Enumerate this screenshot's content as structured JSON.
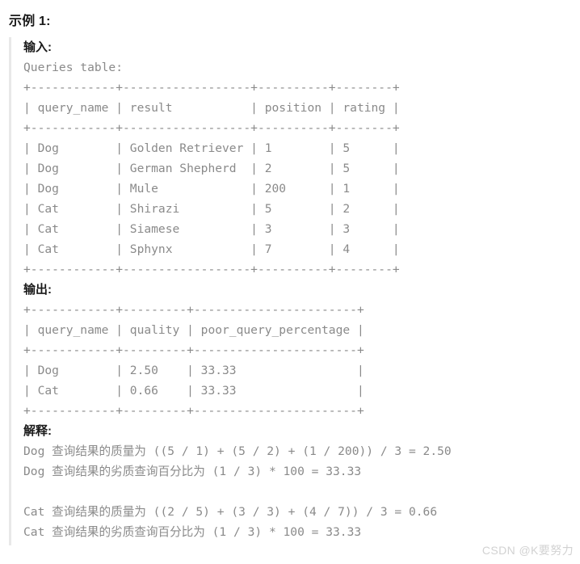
{
  "section": {
    "title": "示例 1:"
  },
  "input": {
    "label": "输入:",
    "caption": "Queries table:",
    "ascii_table": "+------------+------------------+----------+--------+\n| query_name | result           | position | rating |\n+------------+------------------+----------+--------+\n| Dog        | Golden Retriever | 1        | 5      |\n| Dog        | German Shepherd  | 2        | 5      |\n| Dog        | Mule             | 200      | 1      |\n| Cat        | Shirazi          | 5        | 2      |\n| Cat        | Siamese          | 3        | 3      |\n| Cat        | Sphynx           | 7        | 4      |\n+------------+------------------+----------+--------+"
  },
  "output": {
    "label": "输出:",
    "ascii_table": "+------------+---------+-----------------------+\n| query_name | quality | poor_query_percentage |\n+------------+---------+-----------------------+\n| Dog        | 2.50    | 33.33                 |\n| Cat        | 0.66    | 33.33                 |\n+------------+---------+-----------------------+"
  },
  "explanation": {
    "label": "解释:",
    "lines_dog": [
      "Dog 查询结果的质量为 ((5 / 1) + (5 / 2) + (1 / 200)) / 3 = 2.50",
      "Dog 查询结果的劣质查询百分比为 (1 / 3) * 100 = 33.33"
    ],
    "lines_cat": [
      "Cat 查询结果的质量为 ((2 / 5) + (3 / 3) + (4 / 7)) / 3 = 0.66",
      "Cat 查询结果的劣质查询百分比为 (1 / 3) * 100 = 33.33"
    ]
  },
  "watermark": {
    "text": "CSDN @K要努力"
  },
  "colors": {
    "text_primary": "#1a1a1a",
    "mono_text": "#8a8a8a",
    "quote_rule": "#e8e8e8",
    "watermark": "#d2d2d2",
    "background": "#ffffff"
  }
}
